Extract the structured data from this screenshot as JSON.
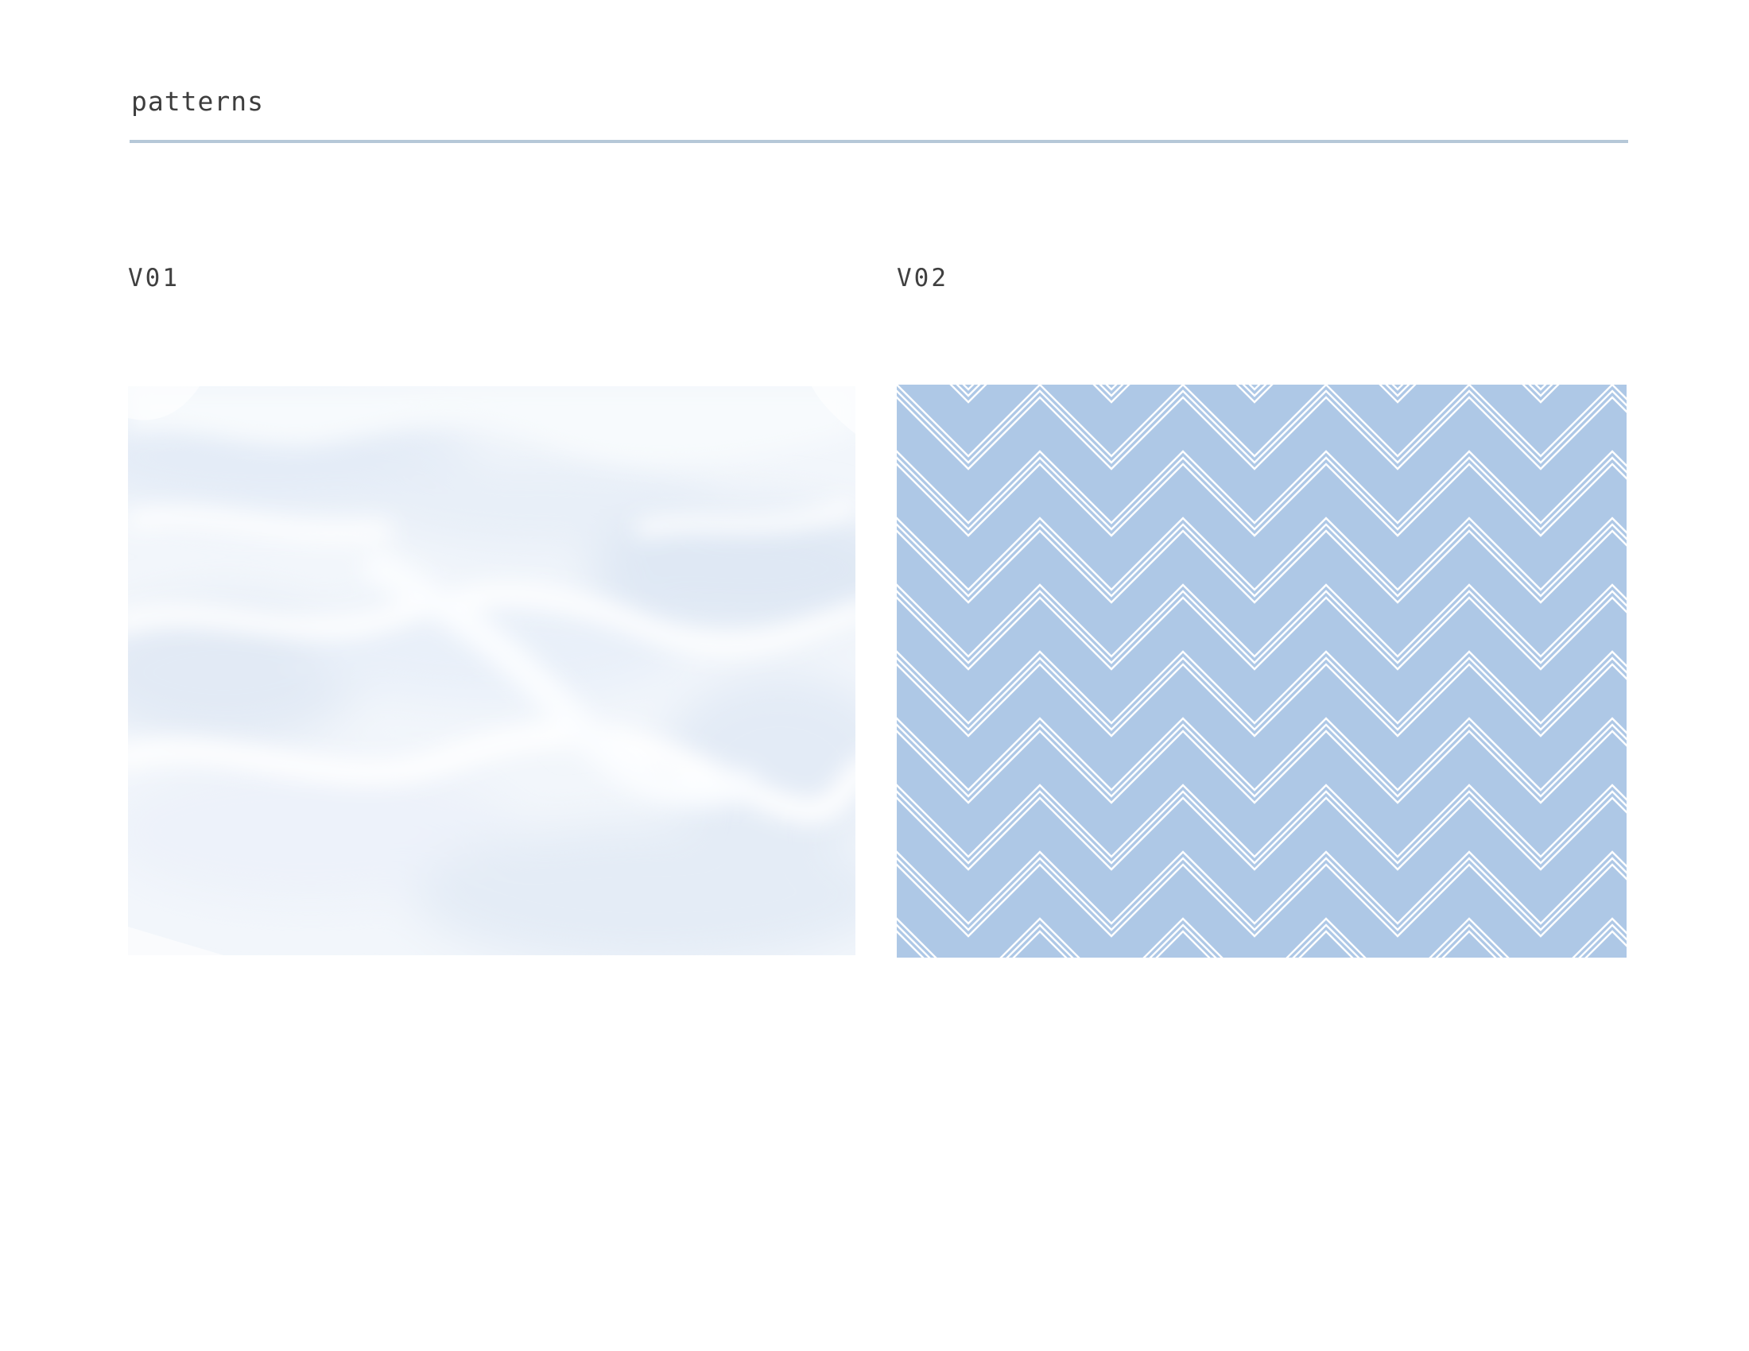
{
  "page": {
    "title": "patterns"
  },
  "patterns": [
    {
      "label": "V01",
      "style": "watercolor-clouds",
      "colors": [
        "#f3f7fc",
        "#e6eef8",
        "#dde8f4",
        "#ffffff"
      ]
    },
    {
      "label": "V02",
      "style": "chevron-zigzag",
      "colors": [
        "#aec8e6",
        "#ffffff"
      ]
    }
  ],
  "colors": {
    "rule": "#b6c8d8",
    "text": "#3d3d3d"
  }
}
